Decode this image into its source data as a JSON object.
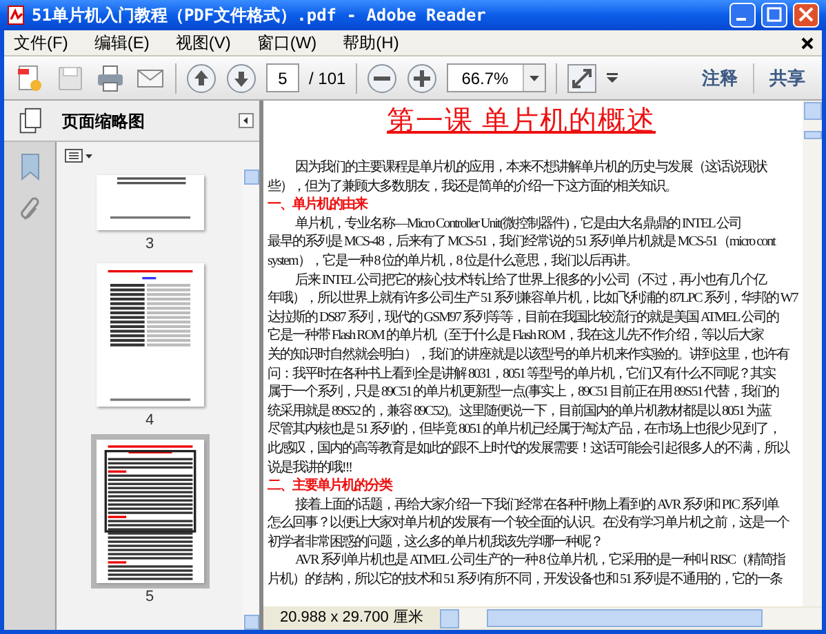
{
  "window": {
    "title": "51单片机入门教程（PDF文件格式）.pdf - Adobe Reader"
  },
  "menu": [
    "文件(F)",
    "编辑(E)",
    "视图(V)",
    "窗口(W)",
    "帮助(H)"
  ],
  "toolbar": {
    "page_number": "5",
    "page_total": "/ 101",
    "zoom": "66.7%",
    "buttons": [
      "注释",
      "共享"
    ]
  },
  "sidebar": {
    "title": "页面缩略图",
    "thumbnails": [
      {
        "label": "3",
        "selected": false,
        "kind": "tail"
      },
      {
        "label": "4",
        "selected": false,
        "kind": "table"
      },
      {
        "label": "5",
        "selected": true,
        "kind": "text"
      }
    ]
  },
  "document": {
    "title": "第一课 单片机的概述",
    "lines": [
      {
        "kind": "indent",
        "text": "因为我们的主要课程是单片机的应用，本来不想讲解单片机的历史与发展（这话说现状"
      },
      {
        "kind": "plain",
        "text": "些），但为了兼顾大多数朋友，我还是简单的介绍一下这方面的相关知识。"
      },
      {
        "kind": "heading",
        "text": "一、单片机的由来"
      },
      {
        "kind": "indent",
        "text": "单片机，专业名称—Micro Controller Unit(微控制器件)，它是由大名鼎鼎的 INTEL 公司"
      },
      {
        "kind": "plain",
        "text": "最早的系列是 MCS-48，后来有了 MCS-51，我们经常说的 51 系列单片机就是 MCS-51（micro  cont"
      },
      {
        "kind": "plain",
        "text": "system），它是一种 8 位的单片机，8 位是什么意思，我们以后再讲。"
      },
      {
        "kind": "indent",
        "text": "后来 INTEL 公司把它的核心技术转让给了世界上很多的小公司（不过，再小也有几个亿"
      },
      {
        "kind": "plain",
        "text": "年哦），所以世界上就有许多公司生产 51 系列兼容单片机，比如飞利浦的 87LPC 系列，华邦的 W7"
      },
      {
        "kind": "plain",
        "text": "达拉斯的 DS87 系列，现代的 GSM97 系列等等，目前在我国比较流行的就是美国 ATMEL 公司的"
      },
      {
        "kind": "plain",
        "text": "它是一种带 Flash  ROM 的单片机（至于什么是 Flash  ROM，我在这儿先不作介绍，等以后大家"
      },
      {
        "kind": "plain",
        "text": "关的知识时自然就会明白），我们的讲座就是以该型号的单片机来作实验的。讲到这里，也许有"
      },
      {
        "kind": "plain",
        "text": "问：我平时在各种书上看到全是讲解 8031，8051 等型号的单片机，它们又有什么不同呢？其实"
      },
      {
        "kind": "plain",
        "text": "属于一个系列，只是 89C51 的单片机更新型一点(事实上，89C51 目前正在用 89S51 代替，我们的"
      },
      {
        "kind": "plain",
        "text": "统采用就是 89S52 的，兼容 89C52)。这里随便说一下，目前国内的单片机教材都是以 8051 为蓝"
      },
      {
        "kind": "plain",
        "text": "尽管其内核也是 51 系列的，但毕竟 8051 的单片机已经属于淘汰产品，在市场上也很少见到了，"
      },
      {
        "kind": "plain",
        "text": "此感叹，国内的高等教育是如此的跟不上时代的发展需要！这话可能会引起很多人的不满，所以"
      },
      {
        "kind": "plain",
        "text": "说是我讲的哦!!!"
      },
      {
        "kind": "heading",
        "text": "二、主要单片机的分类"
      },
      {
        "kind": "indent",
        "text": "接着上面的话题，再给大家介绍一下我们经常在各种刊物上看到的 AVR 系列和 PIC 系列单"
      },
      {
        "kind": "plain",
        "text": "怎么回事？以便让大家对单片机的发展有一个较全面的认识。在没有学习单片机之前，这是一个"
      },
      {
        "kind": "plain",
        "text": "初学者非常困惑的问题，这么多的单片机我该先学哪一种呢？"
      },
      {
        "kind": "indent",
        "text": "AVR 系列单片机也是 ATMEL 公司生产的一种 8 位单片机，它采用的是一种叫 RISC（精简指"
      },
      {
        "kind": "plain",
        "text": "片机）的结构，所以它的技术和 51 系列有所不同，开发设备也和 51 系列是不通用的，它的一条"
      }
    ]
  },
  "status_bar": {
    "page_size": "20.988 x 29.700 厘米"
  }
}
